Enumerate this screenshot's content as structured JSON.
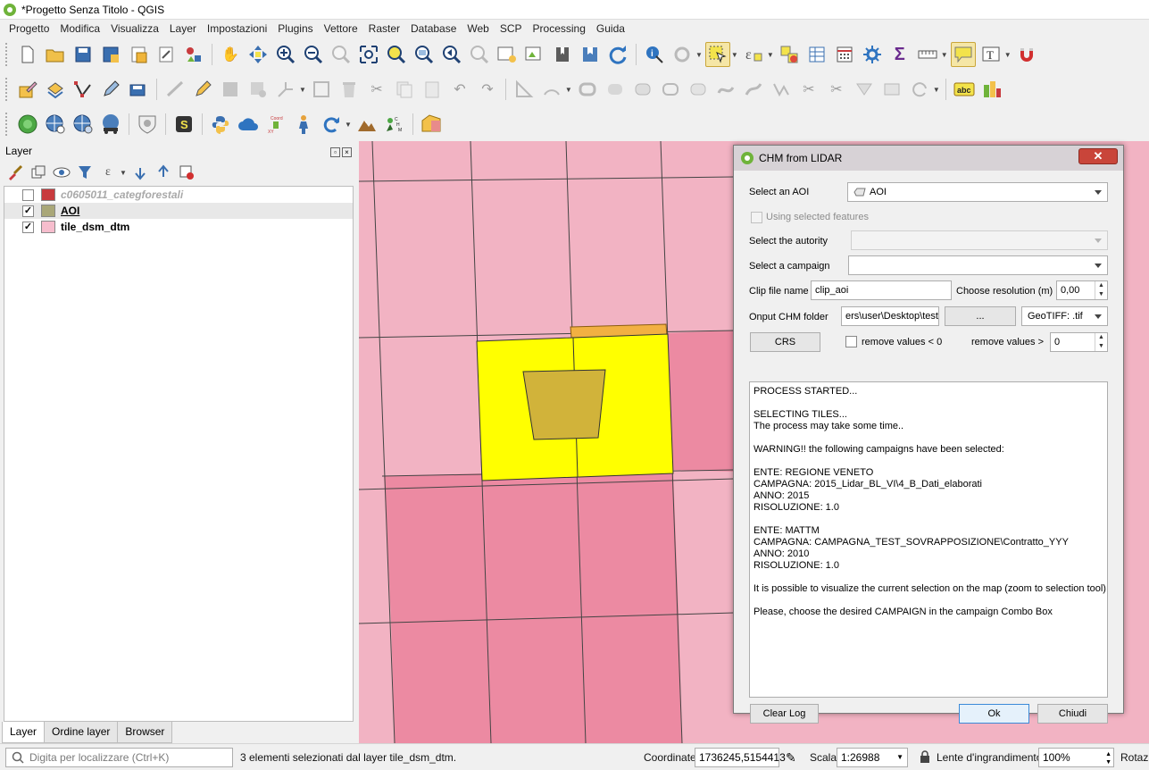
{
  "window": {
    "title": "*Progetto Senza Titolo - QGIS"
  },
  "menu": [
    "Progetto",
    "Modifica",
    "Visualizza",
    "Layer",
    "Impostazioni",
    "Plugins",
    "Vettore",
    "Raster",
    "Database",
    "Web",
    "SCP",
    "Processing",
    "Guida"
  ],
  "layer_panel": {
    "title": "Layer",
    "layers": [
      {
        "name": "c0605011_categforestali",
        "checked": false,
        "color": "#c83b3e"
      },
      {
        "name": "AOI",
        "checked": true,
        "color": "#a9a778"
      },
      {
        "name": "tile_dsm_dtm",
        "checked": true,
        "color": "#f6bdcd"
      }
    ],
    "tabs": [
      "Layer",
      "Ordine layer",
      "Browser"
    ],
    "checkmark": "✓"
  },
  "dialog": {
    "title": "CHM from LIDAR",
    "close_glyph": "✕",
    "select_aoi_label": "Select an AOI",
    "select_aoi_value": "AOI",
    "using_selected_label": "Using selected features",
    "select_autority_label": "Select the autority",
    "select_autority_value": "",
    "select_campaign_label": "Select a campaign",
    "select_campaign_value": "",
    "clip_file_label": "Clip file name",
    "clip_file_value": "clip_aoi",
    "choose_resolution_label": "Choose resolution (m)",
    "resolution_value": "0,00",
    "output_folder_label": "Onput CHM folder",
    "output_folder_value": "ers\\user\\Desktop\\test",
    "browse_label": "...",
    "format_value": "GeoTIFF: .tif",
    "crs_label": "CRS",
    "remove_lt0_label": "remove values < 0",
    "remove_gt_label": "remove values >",
    "remove_gt_value": "0",
    "log_lines": [
      "PROCESS STARTED...",
      "",
      "SELECTING TILES...",
      "The process may take some time..",
      "",
      "WARNING!! the following campaigns have been selected:",
      "",
      "ENTE: REGIONE VENETO",
      "CAMPAGNA: 2015_Lidar_BL_VI\\4_B_Dati_elaborati",
      "ANNO: 2015",
      "RISOLUZIONE: 1.0",
      "",
      "ENTE: MATTM",
      "CAMPAGNA: CAMPAGNA_TEST_SOVRAPPOSIZIONE\\Contratto_YYY",
      "ANNO: 2010",
      "RISOLUZIONE: 1.0",
      "",
      "It is possible to visualize the current selection on the map (zoom to selection tool)",
      "",
      "Please, choose the desired CAMPAIGN in the campaign Combo Box"
    ],
    "clear_log_label": "Clear Log",
    "ok_label": "Ok",
    "close_label": "Chiudi"
  },
  "statusbar": {
    "locator_placeholder": "Digita per localizzare (Ctrl+K)",
    "message": "3 elementi selezionati dal layer tile_dsm_dtm.",
    "coord_label": "Coordinate",
    "coord_value": "1736245,5154413",
    "scale_label": "Scala",
    "scale_value": "1:26988",
    "magnifier_label": "Lente d'ingrandimento",
    "magnifier_value": "100%",
    "rotation_label": "Rotazi"
  },
  "colors": {
    "tile_pink": "#f2b3c3",
    "tile_dark": "#ec8aa2",
    "aoi_yellow": "#ffff00",
    "forest_tan": "#d1b33a",
    "orange": "#f2b042"
  }
}
